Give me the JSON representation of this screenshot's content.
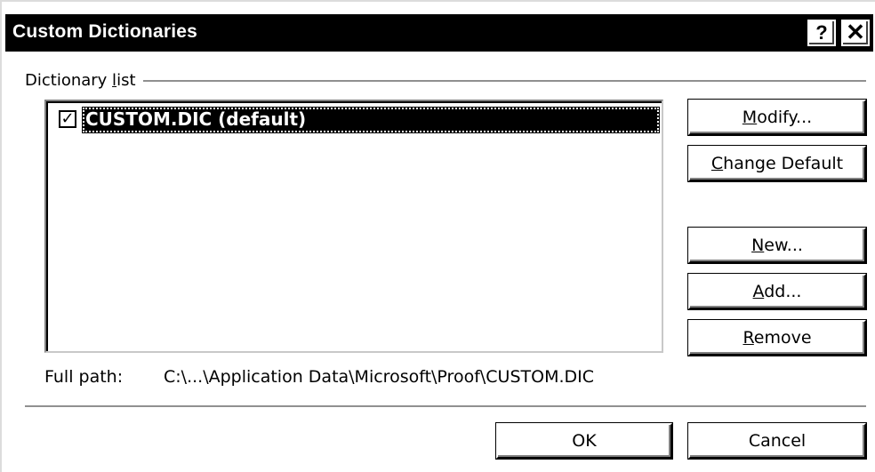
{
  "window": {
    "title": "Custom Dictionaries",
    "help_glyph": "?",
    "close_glyph": "✕"
  },
  "dictionary_list": {
    "group_label_prefix": "Dictionary ",
    "group_label_accel": "l",
    "group_label_suffix": "ist",
    "items": [
      {
        "label": "CUSTOM.DIC (default)",
        "checked": true,
        "check_glyph": "✓",
        "selected": true
      }
    ]
  },
  "buttons": {
    "modify": {
      "accel": "M",
      "rest": "odify..."
    },
    "change_default": {
      "accel": "C",
      "rest": "hange Default"
    },
    "new": {
      "accel": "N",
      "rest": "ew..."
    },
    "add": {
      "accel": "A",
      "rest": "dd..."
    },
    "remove": {
      "accel": "R",
      "rest": "emove"
    },
    "ok": "OK",
    "cancel": "Cancel"
  },
  "full_path": {
    "label": "Full path:",
    "value": "C:\\...\\Application Data\\Microsoft\\Proof\\CUSTOM.DIC"
  },
  "colors": {
    "titlebar": "#000000",
    "background": "#ffffff",
    "selection": "#000000"
  }
}
